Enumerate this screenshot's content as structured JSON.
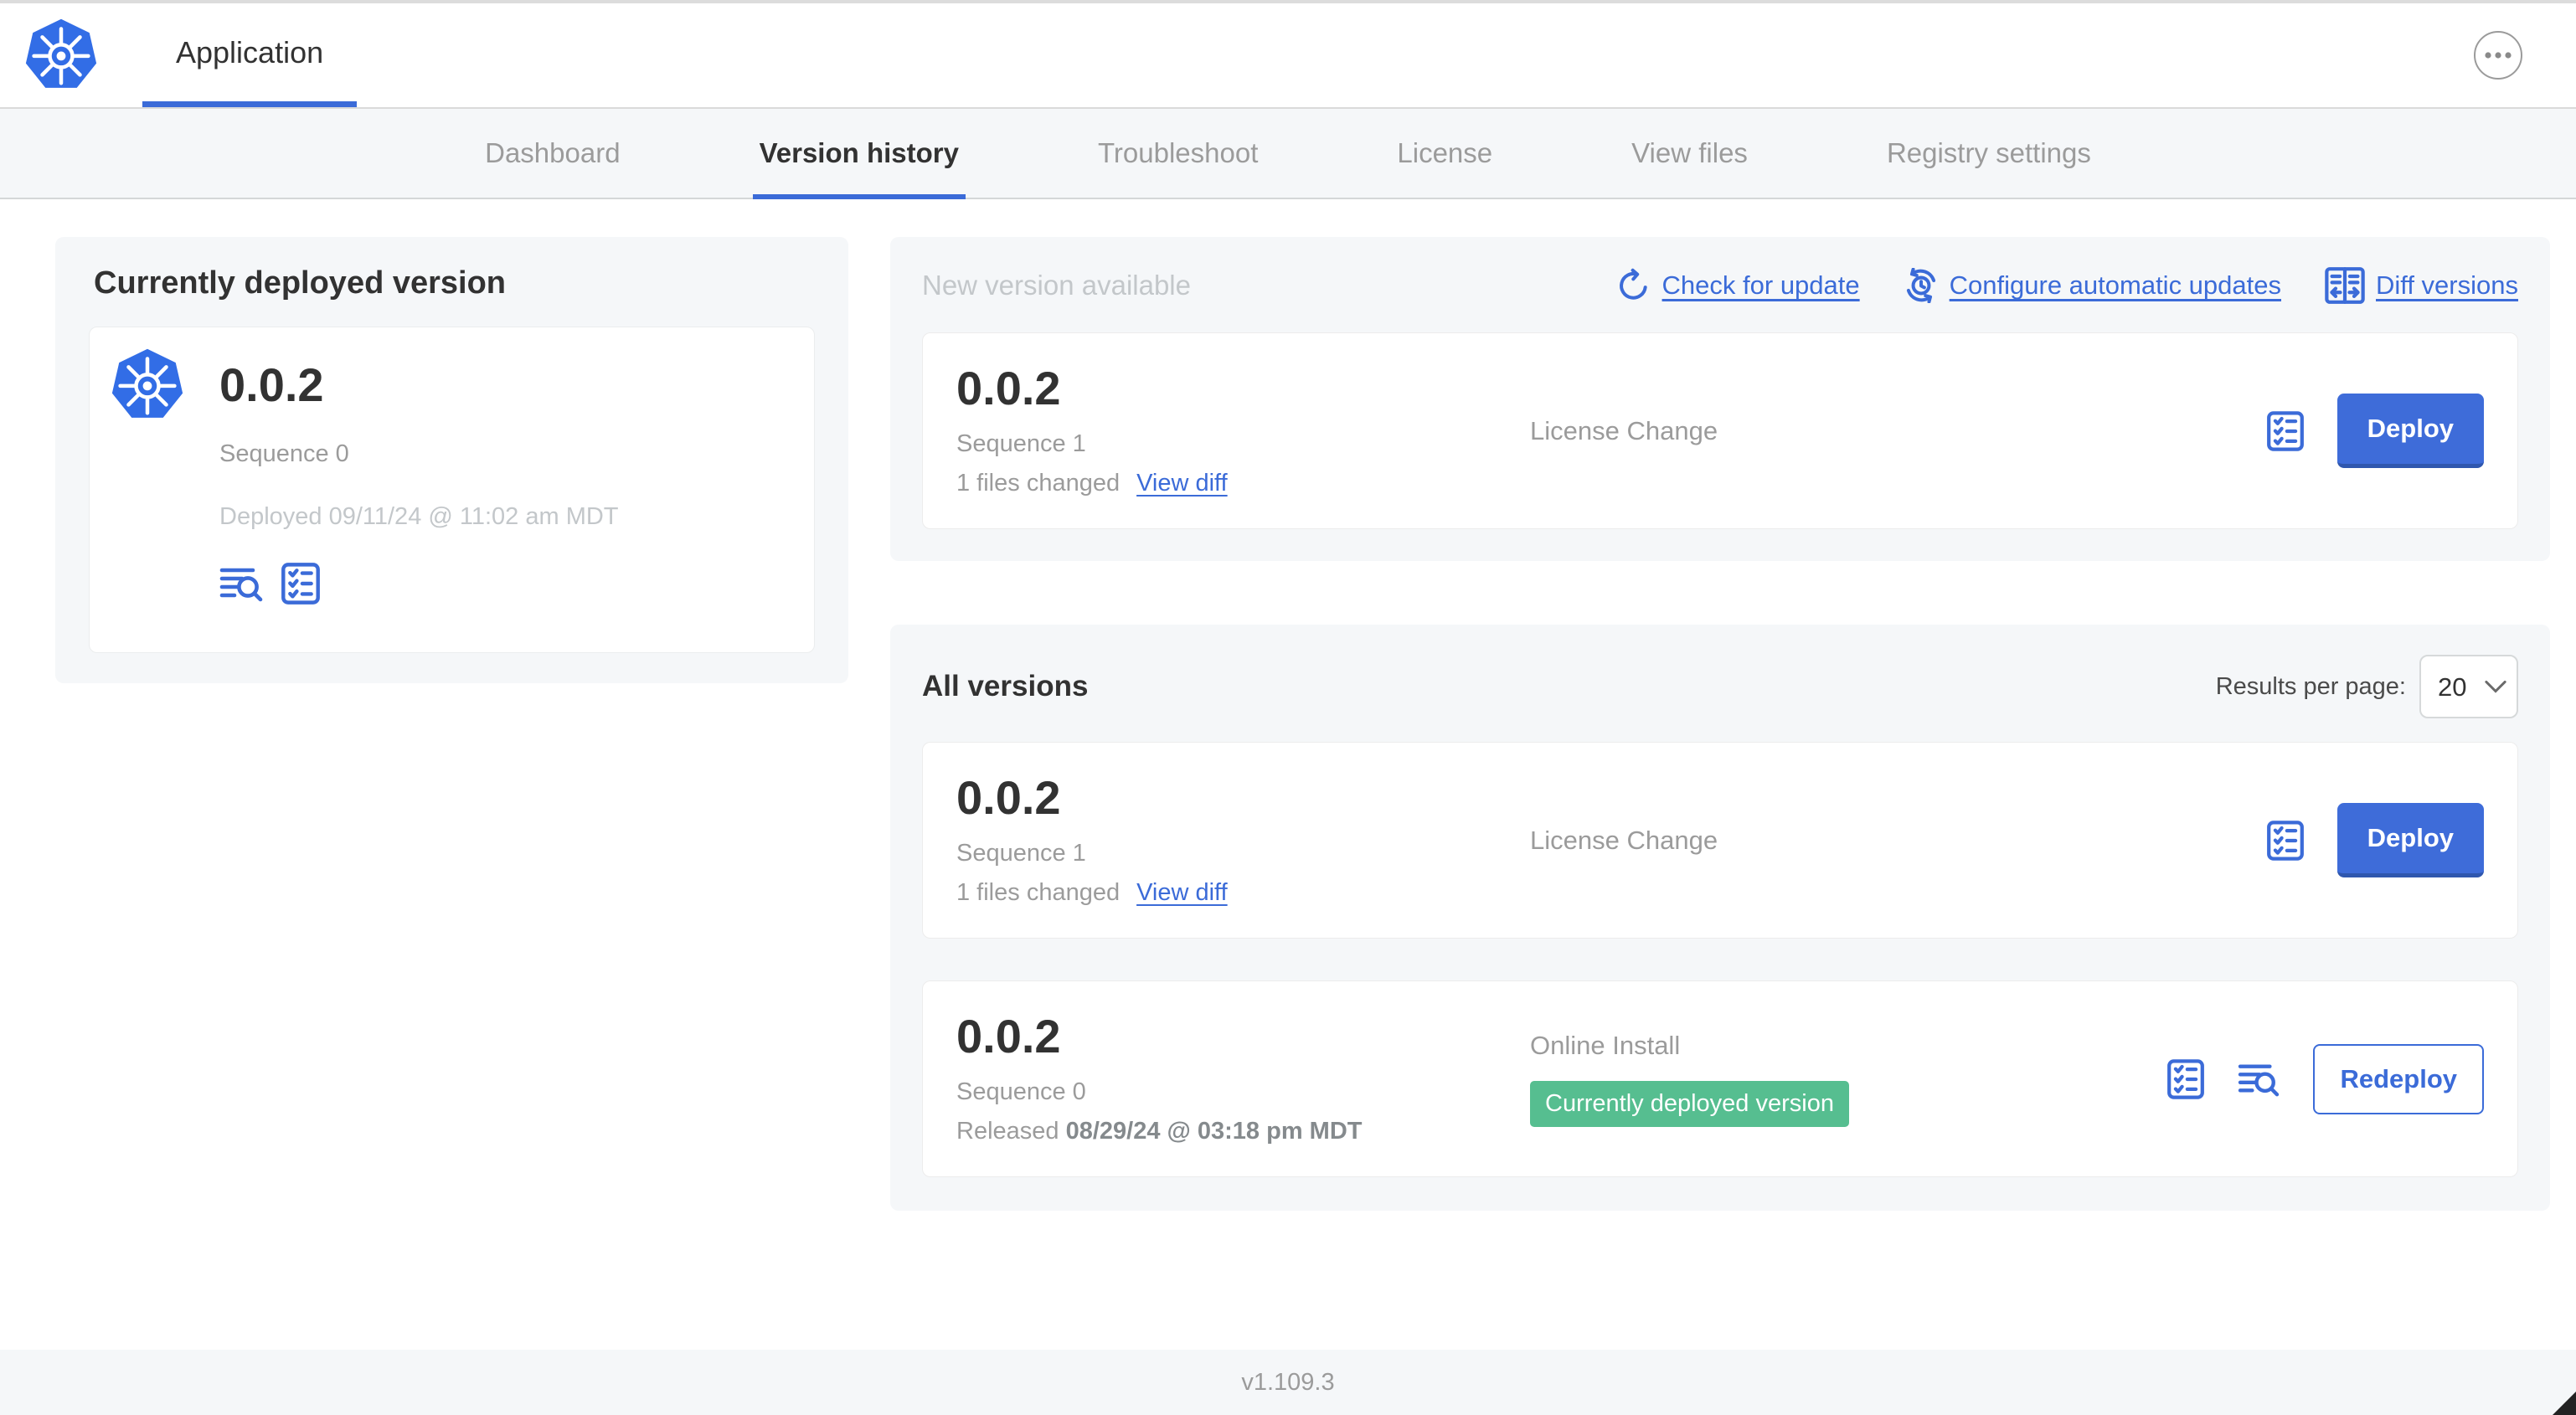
{
  "header": {
    "app_tab_label": "Application",
    "more_button": "more-options"
  },
  "nav": {
    "active_tab": "Version history",
    "tabs": [
      {
        "label": "Dashboard"
      },
      {
        "label": "Version history"
      },
      {
        "label": "Troubleshoot"
      },
      {
        "label": "License"
      },
      {
        "label": "View files"
      },
      {
        "label": "Registry settings"
      }
    ]
  },
  "current_version_panel": {
    "title": "Currently deployed version",
    "version": "0.0.2",
    "sequence": "Sequence 0",
    "deployed": "Deployed 09/11/24 @ 11:02 am MDT",
    "icons": [
      "view-logs-icon",
      "version-config-icon"
    ]
  },
  "new_version_panel": {
    "title": "New version available",
    "actions": [
      {
        "label": "Check for update",
        "icon": "refresh-icon"
      },
      {
        "label": "Configure automatic updates",
        "icon": "clock-refresh-icon"
      },
      {
        "label": "Diff versions",
        "icon": "diff-icon"
      }
    ],
    "row": {
      "version": "0.0.2",
      "sequence": "Sequence 1",
      "files_changed": "1 files changed",
      "view_diff": "View diff",
      "source": "License Change",
      "action_label": "Deploy"
    }
  },
  "all_versions_panel": {
    "title": "All versions",
    "results_per_page_label": "Results per page:",
    "results_per_page_value": "20",
    "rows": [
      {
        "version": "0.0.2",
        "sequence": "Sequence 1",
        "files_changed": "1 files changed",
        "view_diff": "View diff",
        "source": "License Change",
        "action_label": "Deploy"
      },
      {
        "version": "0.0.2",
        "sequence": "Sequence 0",
        "released_prefix": "Released ",
        "released_date": "08/29/24 @ 03:18 pm MDT",
        "source": "Online Install",
        "badge": "Currently deployed version",
        "action_label": "Redeploy"
      }
    ]
  },
  "footer": {
    "app_version": "v1.109.3"
  },
  "colors": {
    "primary_blue": "#3b6bd8",
    "logo_blue": "#326de6",
    "badge_green": "#56be90",
    "dark_text": "#323232",
    "gray_text": "#9b9b9b",
    "muted_text": "#c3c7ca",
    "panel_bg": "#f5f7f9"
  }
}
